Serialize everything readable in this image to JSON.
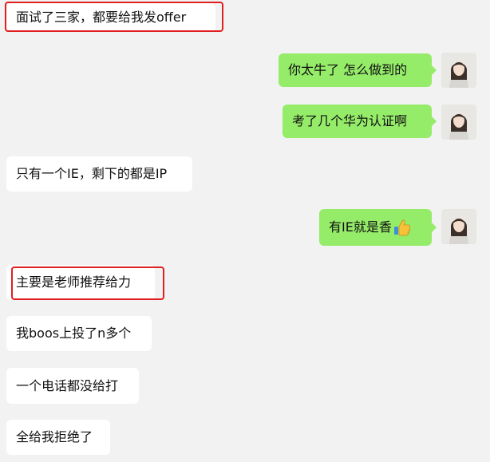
{
  "messages": [
    {
      "side": "left",
      "text": "面试了三家，都要给我发offer"
    },
    {
      "side": "right",
      "text": "你太牛了 怎么做到的"
    },
    {
      "side": "right",
      "text": "考了几个华为认证啊"
    },
    {
      "side": "left",
      "text": "只有一个IE，剩下的都是IP"
    },
    {
      "side": "right",
      "text": "有IE就是香",
      "emoji": "thumbs-up-icon"
    },
    {
      "side": "left",
      "text": "主要是老师推荐给力"
    },
    {
      "side": "left",
      "text": "我boos上投了n多个"
    },
    {
      "side": "left",
      "text": "一个电话都没给打"
    },
    {
      "side": "left",
      "text": "全给我拒绝了"
    }
  ],
  "colors": {
    "background": "#f2f2f2",
    "incoming_bubble": "#ffffff",
    "outgoing_bubble": "#95ec69",
    "highlight_box": "#e02020"
  }
}
